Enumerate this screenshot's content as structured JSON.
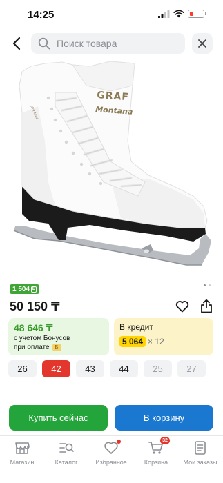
{
  "status_bar": {
    "time": "14:25"
  },
  "header": {
    "search_placeholder": "Поиск товара"
  },
  "product": {
    "bonus_badge": "1 504",
    "bonus_coin": "Б",
    "price": "50 150 ₸",
    "image_brand_text_1": "GRAF",
    "image_brand_text_2": "Montana"
  },
  "bonus": {
    "amount": "48 646 ₸",
    "line1": "с учетом Бонусов",
    "line2": "при оплате",
    "icon_text": "Б"
  },
  "credit": {
    "title": "В кредит",
    "amount": "5 064",
    "multiplier": "× 12"
  },
  "sizes": [
    {
      "label": "26",
      "state": "normal"
    },
    {
      "label": "42",
      "state": "selected"
    },
    {
      "label": "43",
      "state": "normal"
    },
    {
      "label": "44",
      "state": "normal"
    },
    {
      "label": "25",
      "state": "disabled"
    },
    {
      "label": "27",
      "state": "disabled"
    },
    {
      "label": "",
      "state": "disabled"
    }
  ],
  "actions": {
    "buy_now": "Купить сейчас",
    "add_to_cart": "В корзину"
  },
  "tabs": [
    {
      "label": "Магазин",
      "icon": "store-icon"
    },
    {
      "label": "Каталог",
      "icon": "catalog-icon"
    },
    {
      "label": "Избранное",
      "icon": "heart-icon"
    },
    {
      "label": "Корзина",
      "icon": "cart-icon",
      "badge": "32"
    },
    {
      "label": "Мои заказы",
      "icon": "orders-icon"
    }
  ],
  "colors": {
    "primary_green": "#24a53b",
    "primary_blue": "#1a78d0",
    "accent_red": "#e3362c",
    "credit_yellow": "#ffd400"
  }
}
